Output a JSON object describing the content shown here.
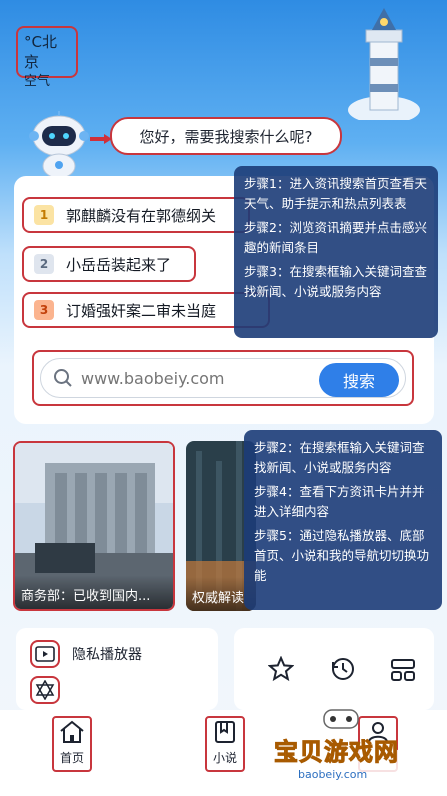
{
  "weather": {
    "temp_city": "°C北京",
    "air": "空气"
  },
  "assistant": {
    "greeting": "您好，需要我搜索什么呢?"
  },
  "hot_list": [
    {
      "rank": "1",
      "title": "郭麒麟没有在郭德纲关"
    },
    {
      "rank": "2",
      "title": "小岳岳装起来了"
    },
    {
      "rank": "3",
      "title": "订婚强奸案二审未当庭"
    }
  ],
  "search": {
    "placeholder": "www.baobeiy.com",
    "button": "搜索"
  },
  "overlay_top": [
    "步骤1：进入资讯搜索首页查看天天气、助手提示和热点列表表",
    "步骤2：浏览资讯摘要并点击感兴趣的新闻条目",
    "步骤3：在搜索框输入关键词查查找新闻、小说或服务内容"
  ],
  "overlay_bottom": [
    "步骤2：在搜索框输入关键词查找新闻、小说或服务内容",
    "步骤4：查看下方资讯卡片并并进入详细内容",
    "步骤5：通过隐私播放器、底部首页、小说和我的导航切切换功能"
  ],
  "news": [
    {
      "caption": "商务部：已收到国内..."
    },
    {
      "caption": "权威解读"
    }
  ],
  "features": {
    "private_player": "隐私播放器"
  },
  "nav": {
    "home": "首页",
    "novel": "小说"
  },
  "watermark": {
    "text": "宝贝游戏网",
    "url": "baobeiy.com"
  },
  "colors": {
    "accent": "#2f7fe8",
    "highlight_border": "#c8363d",
    "overlay": "#1c3c78"
  }
}
